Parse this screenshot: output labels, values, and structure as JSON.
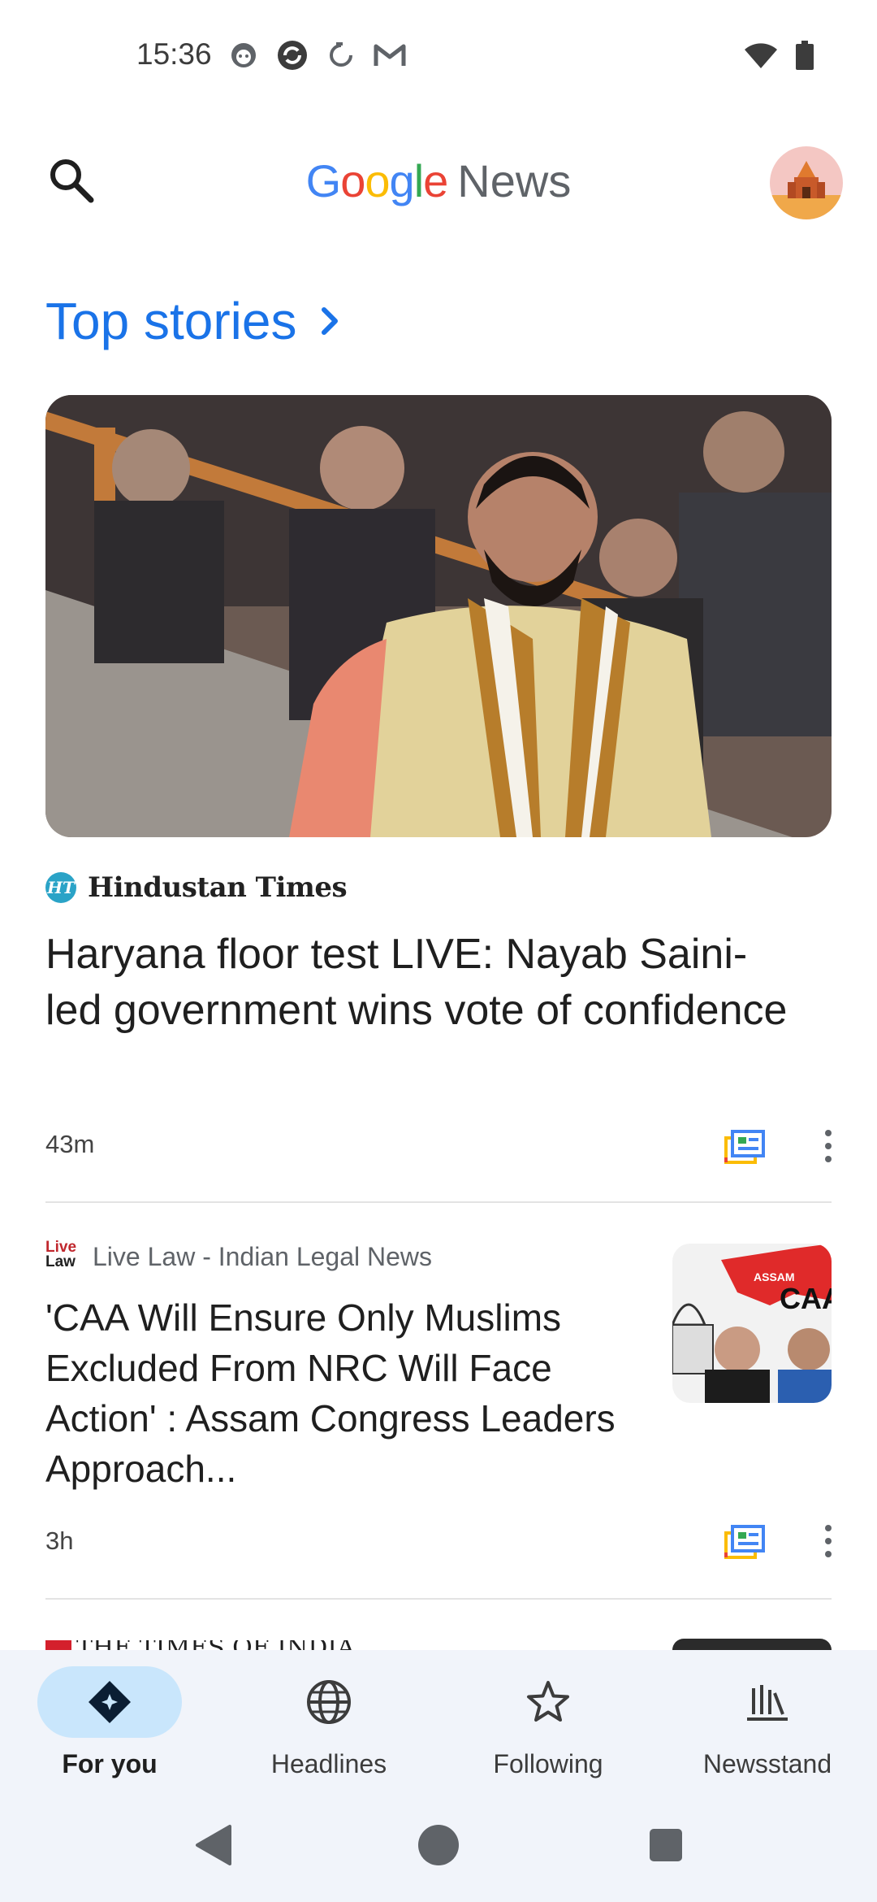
{
  "status_bar": {
    "time": "15:36",
    "notification_icons": [
      "face-icon",
      "sync-icon",
      "loading-icon",
      "gmail-icon"
    ],
    "right_icons": [
      "wifi-icon",
      "battery-icon"
    ]
  },
  "app_bar": {
    "title_brand": "Google",
    "title_product": "News",
    "brand_colors": [
      "#4285F4",
      "#EA4335",
      "#FBBC05",
      "#4285F4",
      "#34A853",
      "#EA4335"
    ]
  },
  "section": {
    "title": "Top stories"
  },
  "stories": [
    {
      "source": "Hindustan Times",
      "source_logo_text": "HT",
      "headline": "Haryana floor test LIVE: Nayab Saini-led government wins vote of confidence",
      "time": "43m"
    },
    {
      "source": "Live Law - Indian Legal News",
      "source_logo_text": "Live Law",
      "headline": "'CAA Will Ensure Only Muslims Excluded From NRC Will Face Action' : Assam Congress Leaders Approach...",
      "time": "3h",
      "thumb_text": [
        "ASSAM",
        "CAA"
      ]
    },
    {
      "source": "THE TIMES OF INDIA"
    }
  ],
  "bottom_nav": [
    {
      "label": "For you",
      "icon": "diamond-icon",
      "active": true
    },
    {
      "label": "Headlines",
      "icon": "globe-icon",
      "active": false
    },
    {
      "label": "Following",
      "icon": "star-icon",
      "active": false
    },
    {
      "label": "Newsstand",
      "icon": "newsstand-icon",
      "active": false
    }
  ],
  "colors": {
    "accent": "#1a73e8",
    "active_pill": "#c9e6fc",
    "nav_bg": "#f1f4fa"
  }
}
